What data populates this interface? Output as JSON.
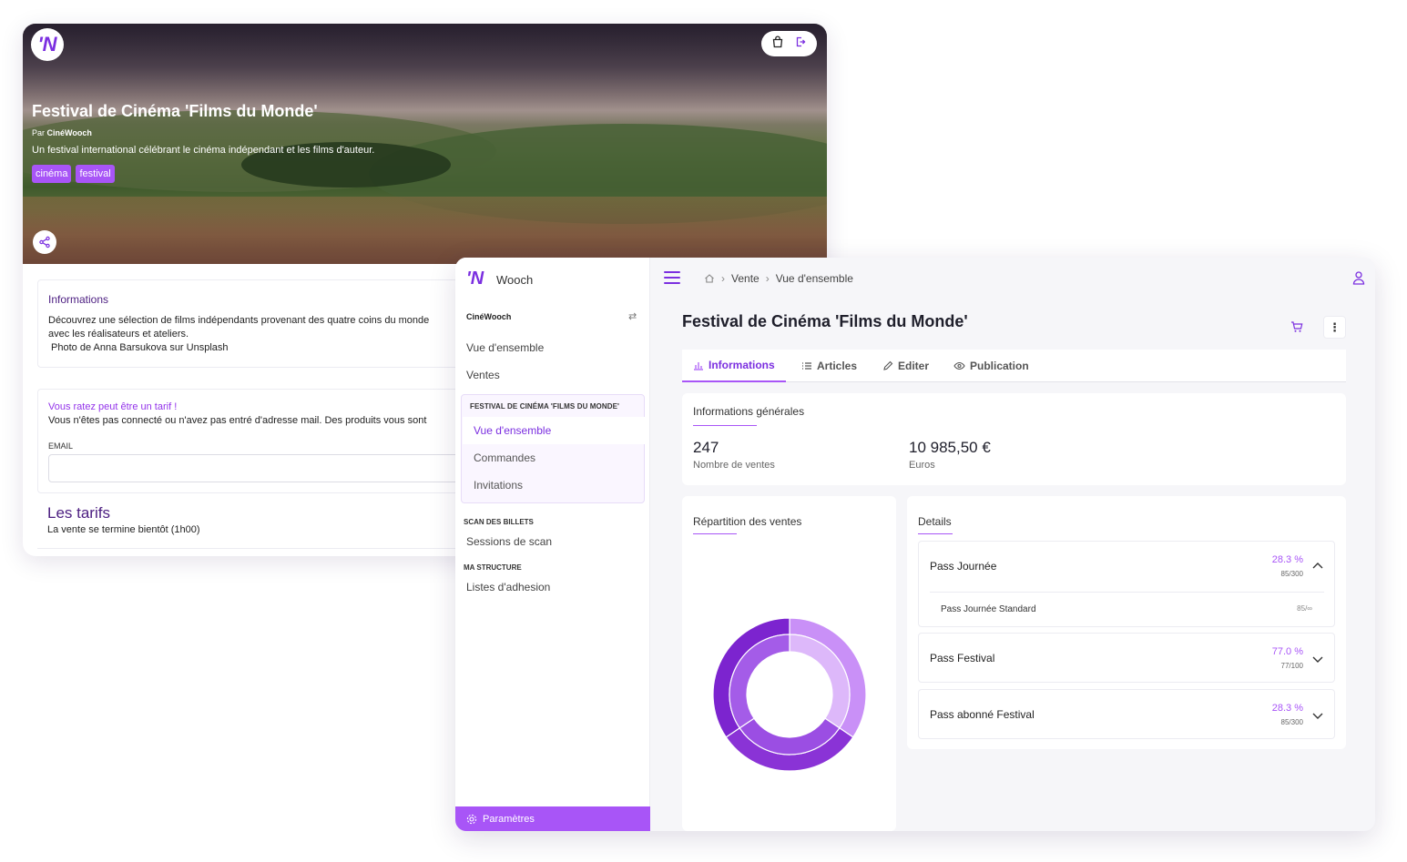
{
  "public_page": {
    "event_title": "Festival de Cinéma 'Films du Monde'",
    "by_prefix": "Par",
    "organizer": "CinéWooch",
    "description": "Un festival international célébrant le cinéma indépendant et les films d'auteur.",
    "tags": [
      "cinéma",
      "festival"
    ],
    "logo_letter": "'N",
    "info_card": {
      "title": "Informations",
      "line1": "Découvrez une sélection de films indépendants provenant des quatre coins du monde",
      "line2": "avec les réalisateurs et ateliers.",
      "line3": " Photo de Anna Barsukova sur Unsplash"
    },
    "tarif_card": {
      "title": "Vous ratez peut être un tarif !",
      "text": "Vous n'êtes pas connecté ou n'avez pas entré d'adresse mail. Des produits vous sont",
      "email_label": "EMAIL",
      "email_placeholder": ""
    },
    "tarifs": {
      "title": "Les tarifs",
      "subtitle": "La vente se termine bientôt (1h00)"
    }
  },
  "admin": {
    "app_name": "Wooch",
    "logo_letter": "'N",
    "organization": "CinéWooch",
    "nav": {
      "overview": "Vue d'ensemble",
      "sales": "Ventes"
    },
    "event_group": {
      "title": "FESTIVAL DE CINÉMA 'FILMS DU MONDE'",
      "items": [
        "Vue d'ensemble",
        "Commandes",
        "Invitations"
      ],
      "active_index": 0
    },
    "sections": [
      {
        "title": "SCAN DES BILLETS",
        "items": [
          "Sessions de scan"
        ]
      },
      {
        "title": "MA STRUCTURE",
        "items": [
          "Listes d'adhesion"
        ]
      }
    ],
    "settings_label": "Paramètres",
    "breadcrumb": [
      "Vente",
      "Vue d'ensemble"
    ],
    "event_title": "Festival de Cinéma 'Films du Monde'",
    "tabs": [
      {
        "label": "Informations",
        "icon": "bar-chart-icon",
        "active": true
      },
      {
        "label": "Articles",
        "icon": "list-icon",
        "active": false
      },
      {
        "label": "Editer",
        "icon": "pencil-icon",
        "active": false
      },
      {
        "label": "Publication",
        "icon": "eye-icon",
        "active": false
      }
    ],
    "general": {
      "title": "Informations générales",
      "kpis": [
        {
          "value": "247",
          "label": "Nombre de ventes"
        },
        {
          "value": "10 985,50 €",
          "label": "Euros"
        }
      ]
    },
    "distribution": {
      "title": "Répartition des ventes"
    },
    "details": {
      "title": "Details",
      "items": [
        {
          "name": "Pass Journée",
          "percent": "28.3 %",
          "fraction": "85/300",
          "expanded": true,
          "sub": [
            {
              "name": "Pass Journée Standard",
              "value": "85/∞"
            }
          ]
        },
        {
          "name": "Pass Festival",
          "percent": "77.0 %",
          "fraction": "77/100",
          "expanded": false
        },
        {
          "name": "Pass abonné Festival",
          "percent": "28.3 %",
          "fraction": "85/300",
          "expanded": false
        }
      ]
    },
    "colors": {
      "accent": "#a855f7",
      "accent_dark": "#7b2fe0",
      "donut_outer": [
        "#c990f7",
        "#8a33d6",
        "#7c24cf"
      ],
      "donut_inner": [
        "#ddb8fa",
        "#9b4ee3",
        "#a45ce8"
      ]
    }
  }
}
